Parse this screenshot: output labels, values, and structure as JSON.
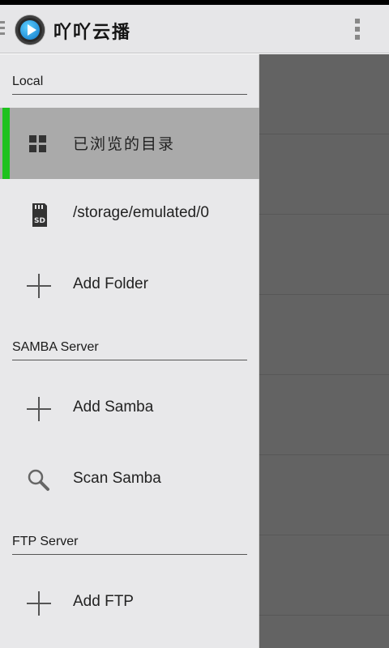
{
  "app": {
    "title": "吖吖云播",
    "logo_icon": "play-logo-icon",
    "overflow_icon": "overflow-menu-icon"
  },
  "drawer": {
    "sections": [
      {
        "header": "Local",
        "items": [
          {
            "label": "已浏览的目录",
            "icon": "grid-icon",
            "selected": true
          },
          {
            "label": "/storage/emulated/0",
            "icon": "sd-card-icon",
            "selected": false
          },
          {
            "label": "Add Folder",
            "icon": "plus-icon",
            "selected": false
          }
        ]
      },
      {
        "header": "SAMBA Server",
        "items": [
          {
            "label": "Add Samba",
            "icon": "plus-icon",
            "selected": false
          },
          {
            "label": "Scan Samba",
            "icon": "search-icon",
            "selected": false
          }
        ]
      },
      {
        "header": "FTP Server",
        "items": [
          {
            "label": "Add FTP",
            "icon": "plus-icon",
            "selected": false
          }
        ]
      }
    ]
  },
  "colors": {
    "accent": "#1ec21e",
    "selected_bg": "#aaaaaa",
    "drawer_bg": "#e8e8ea",
    "content_bg": "#636363"
  }
}
